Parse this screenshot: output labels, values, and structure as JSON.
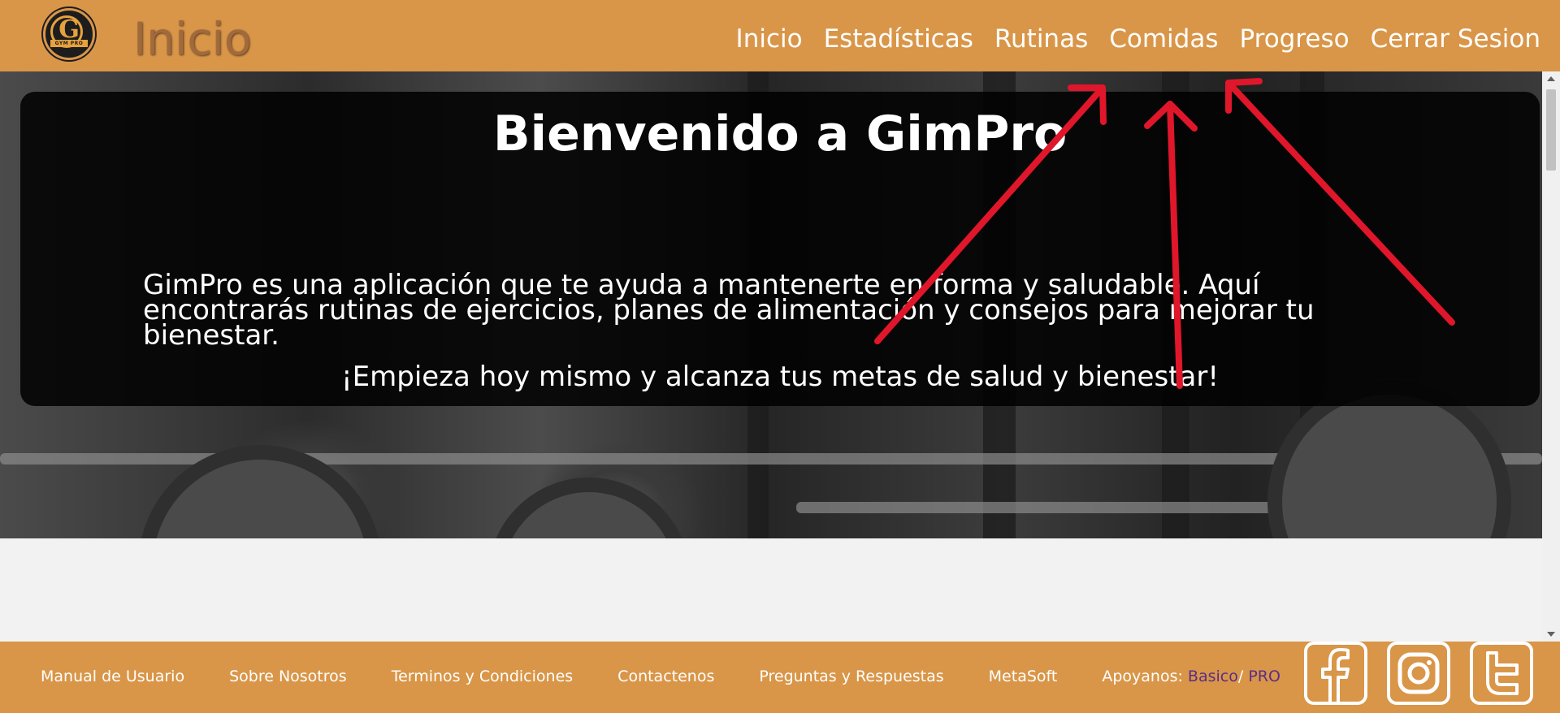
{
  "header": {
    "logo_text": "GYM PRO",
    "logo_letter": "G",
    "title": "Inicio",
    "nav": [
      {
        "label": "Inicio"
      },
      {
        "label": "Estadísticas"
      },
      {
        "label": "Rutinas"
      },
      {
        "label": "Comidas"
      },
      {
        "label": "Progreso"
      },
      {
        "label": "Cerrar Sesion"
      }
    ]
  },
  "hero": {
    "welcome": "Bienvenido a GimPro",
    "intro": "GimPro es una aplicación que te ayuda a mantenerte en forma y saludable. Aquí encontrarás rutinas de ejercicios, planes de alimentación y consejos para mejorar tu bienestar.",
    "cta": "¡Empieza hoy mismo y alcanza tus metas de salud y bienestar!"
  },
  "footer": {
    "links": [
      {
        "label": "Manual de Usuario"
      },
      {
        "label": "Sobre Nosotros"
      },
      {
        "label": "Terminos y Condiciones"
      },
      {
        "label": "Contactenos"
      },
      {
        "label": "Preguntas y Respuestas"
      },
      {
        "label": "MetaSoft"
      }
    ],
    "support_label": "Apoyanos:",
    "support_basic": "Basico",
    "support_sep": "/",
    "support_pro": "PRO",
    "socials": [
      {
        "icon": "facebook-icon"
      },
      {
        "icon": "instagram-icon"
      },
      {
        "icon": "twitter-icon"
      }
    ]
  },
  "colors": {
    "brand": "#d99648",
    "text": "#ffffff",
    "link_support": "#5b2d86",
    "annotation": "#e0162b"
  }
}
